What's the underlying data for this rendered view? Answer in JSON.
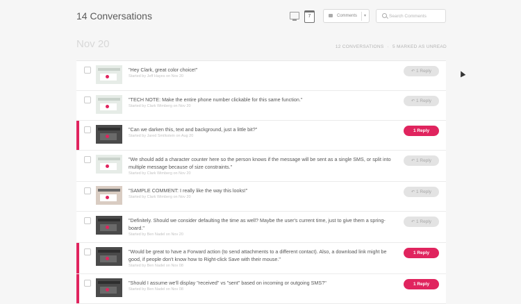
{
  "header": {
    "title": "14 Conversations",
    "calendar_day": "7",
    "comments_button_label": "Comments",
    "search_placeholder": "Search Comments"
  },
  "date_header": "Nov 20",
  "summary": {
    "conversations": "12 CONVERSATIONS",
    "unread": "5 MARKED AS UNREAD"
  },
  "colors": {
    "accent": "#e0245e",
    "reply_read_bg": "#e3e3e3"
  },
  "icons": {
    "desktop": "desktop-icon",
    "calendar": "calendar-icon",
    "comment": "comment-icon",
    "search": "search-icon",
    "reply": "reply-arrow-icon"
  },
  "conversations": [
    {
      "message": "\"Hey Clark, great color choice!\"",
      "byline": "Started by Jeff Hayes on Nov 20",
      "reply": "1 Reply",
      "unread": false
    },
    {
      "message": "\"TECH NOTE: Make the entire phone number clickable for this same function.\"",
      "byline": "Started by Clark Wimberg on Nov 20",
      "reply": "1 Reply",
      "unread": false
    },
    {
      "message": "\"Can we darken this, text and background, just a little bit?\"",
      "byline": "Started by Jared Smilkstein on Aug 20",
      "reply": "1 Reply",
      "unread": true
    },
    {
      "message": "\"We should add a character counter here so the person knows if the message will be sent as a single SMS, or split into multiple message because of size constraints.\"",
      "byline": "Started by Clark Wimberg on Nov 20",
      "reply": "1 Reply",
      "unread": false
    },
    {
      "message": "\"SAMPLE COMMENT: I really like the way this looks!\"",
      "byline": "Started by Clark Wimberg on Nov 20",
      "reply": "1 Reply",
      "unread": false
    },
    {
      "message": "\"Definitely. Should we consider defaulting the time as well? Maybe the user's current time, just to give them a spring-board.\"",
      "byline": "Started by Ben Nadel on Nov 20",
      "reply": "1 Reply",
      "unread": false
    },
    {
      "message": "\"Would be great to have a Forward action (to send attachments to a different contact). Also, a download link might be good, if people don't know how to Right-click Save with their mouse.\"",
      "byline": "Started by Ben Nadel on Nov 08",
      "reply": "1 Reply",
      "unread": true
    },
    {
      "message": "\"Should I assume we'll display \"received\" vs \"sent\" based on incoming or outgoing SMS?\"",
      "byline": "Started by Ben Nadel on Nov 08",
      "reply": "1 Reply",
      "unread": true
    }
  ]
}
